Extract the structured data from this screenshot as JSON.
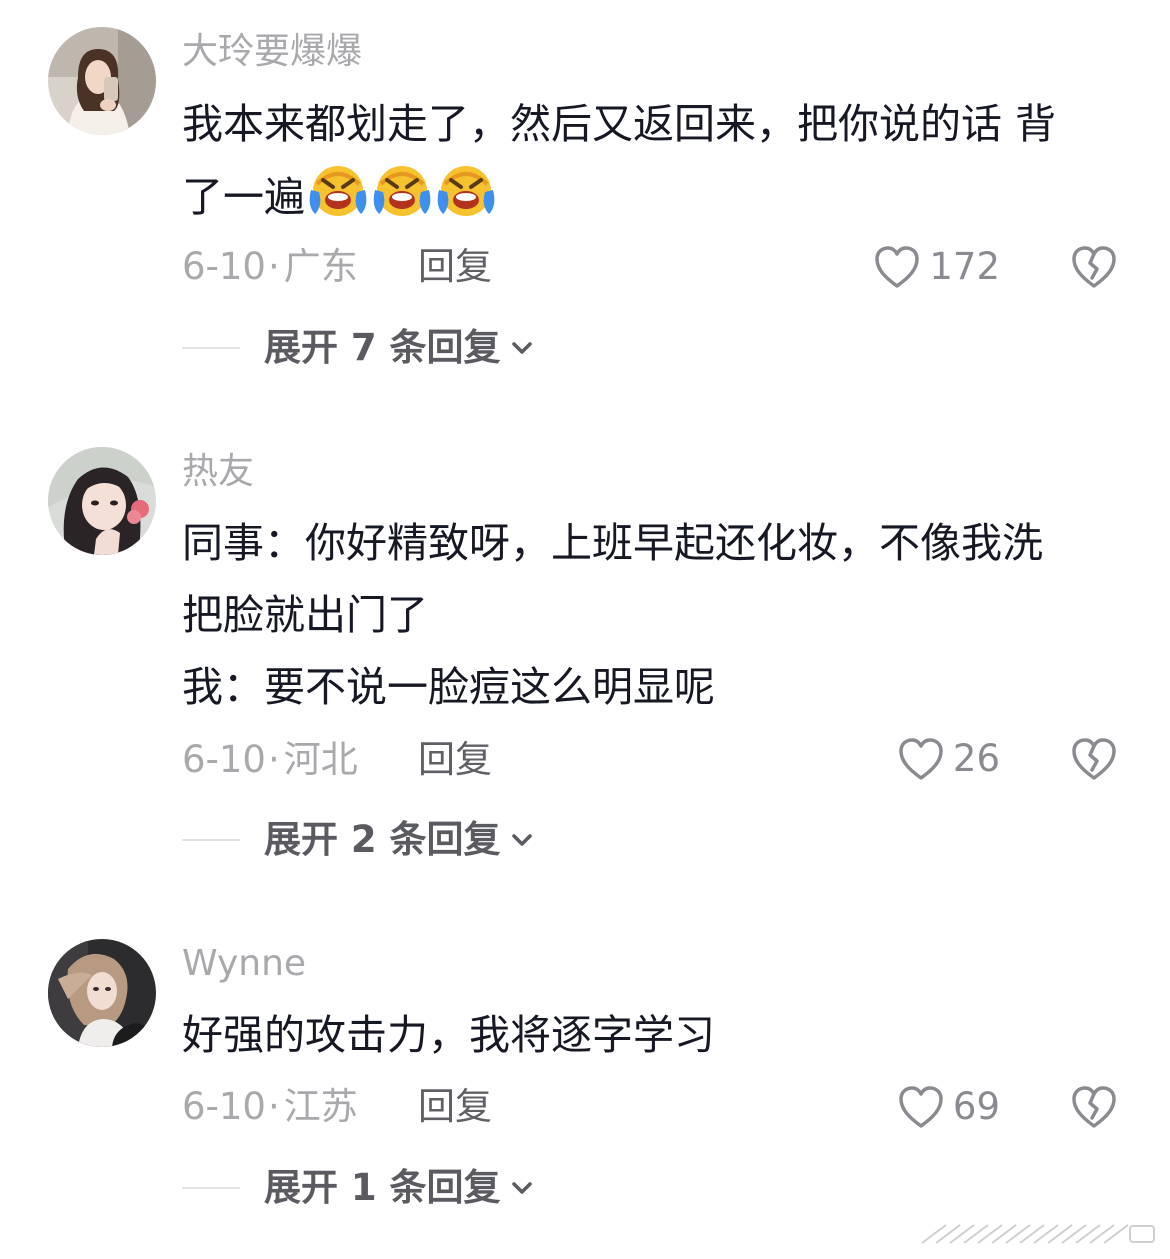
{
  "comments": [
    {
      "username": "大玲要爆爆",
      "lines": [
        "我本来都划走了，然后又返回来，把你说的话 背",
        "了一遍"
      ],
      "emojis": [
        "crying-laughing-emoji",
        "crying-laughing-emoji",
        "crying-laughing-emoji"
      ],
      "date": "6-10",
      "dot": "·",
      "location": "广东",
      "reply_label": "回复",
      "likes": "172",
      "expand_label": "展开 7 条回复"
    },
    {
      "username": "热友",
      "lines": [
        "同事：你好精致呀，上班早起还化妆，不像我洗",
        "把脸就出门了",
        "我：要不说一脸痘这么明显呢"
      ],
      "emojis": [],
      "date": "6-10",
      "dot": "·",
      "location": "河北",
      "reply_label": "回复",
      "likes": "26",
      "expand_label": "展开 2 条回复"
    },
    {
      "username": "Wynne",
      "lines": [
        "好强的攻击力，我将逐字学习"
      ],
      "emojis": [],
      "date": "6-10",
      "dot": "·",
      "location": "江苏",
      "reply_label": "回复",
      "likes": "69",
      "expand_label": "展开 1 条回复"
    }
  ],
  "icons": {
    "like": "heart-outline-icon",
    "dislike": "broken-heart-icon",
    "expand": "chevron-down-icon"
  },
  "colors": {
    "username": "#a9a9ad",
    "body_text": "#161823",
    "meta": "#a9a9ad",
    "icon": "#8a8a90"
  }
}
